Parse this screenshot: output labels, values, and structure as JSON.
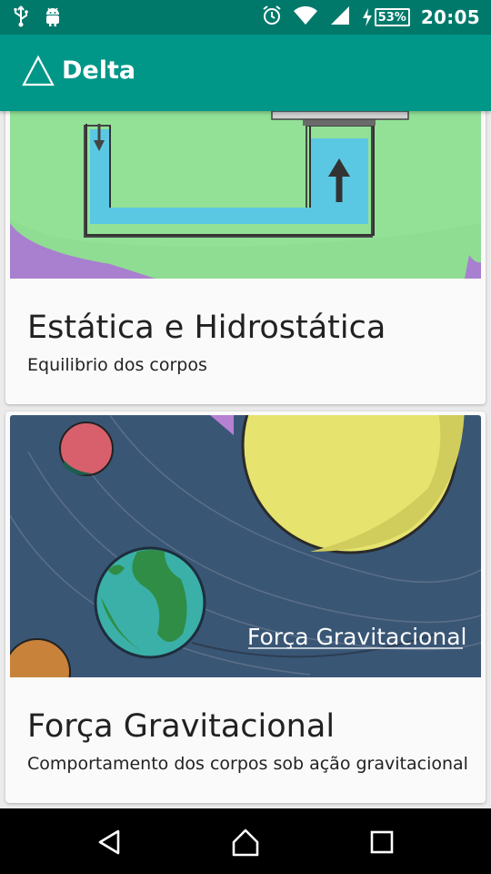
{
  "status_bar": {
    "left_icons": [
      "usb-icon",
      "android-icon"
    ],
    "right_icons": [
      "alarm-icon",
      "wifi-icon",
      "signal-icon",
      "charging-icon"
    ],
    "battery": "53%",
    "time": "20:05"
  },
  "app_bar": {
    "title": "Delta",
    "background": "#009688",
    "status_background": "#00796b"
  },
  "cards": [
    {
      "title": "Estática e Hidrostática",
      "subtitle": "Equilibrio dos corpos"
    },
    {
      "title": "Força Gravitacional",
      "subtitle": "Comportamento dos corpos sob ação gravitacional",
      "image_caption": "Força Gravitacional"
    }
  ],
  "nav_bar": {
    "buttons": [
      "back-icon",
      "home-icon",
      "recents-icon"
    ]
  }
}
